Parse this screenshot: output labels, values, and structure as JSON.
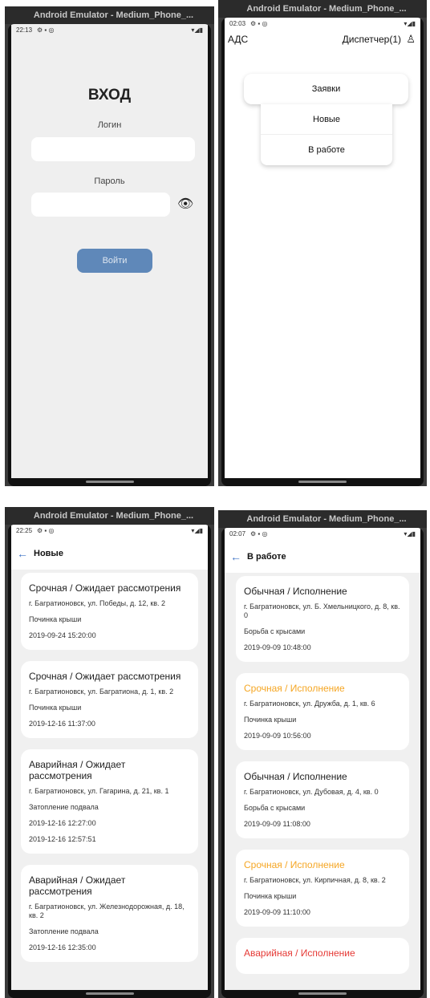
{
  "emulator": {
    "title": "Android Emulator - Medium_Phone_..."
  },
  "colors": {
    "urgent": "#f5a623",
    "emergency": "#e53935",
    "normal": "#222222",
    "accent": "#3e73c5",
    "login_button": "#5f88b9"
  },
  "login": {
    "status_time": "22:13",
    "title": "ВХОД",
    "login_label": "Логин",
    "login_value": "",
    "password_label": "Пароль",
    "password_value": "",
    "eye_icon": "eye-icon",
    "submit_label": "Войти"
  },
  "dispatcher": {
    "status_time": "02:03",
    "app_title": "АДС",
    "user_label": "Диспетчер(1)",
    "user_icon": "user-icon",
    "menu_main": "Заявки",
    "submenu": [
      "Новые",
      "В работе"
    ]
  },
  "new_list": {
    "status_time": "22:25",
    "title": "Новые",
    "cards": [
      {
        "title": "Срочная / Ожидает рассмотрения",
        "status": "normal",
        "lines": [
          "г. Багратионовск, ул. Победы, д. 12, кв. 2",
          "Починка крыши",
          "2019-09-24 15:20:00"
        ]
      },
      {
        "title": "Срочная / Ожидает рассмотрения",
        "status": "normal",
        "lines": [
          "г. Багратионовск, ул. Багратиона, д. 1, кв. 2",
          "Починка крыши",
          "2019-12-16 11:37:00"
        ]
      },
      {
        "title": "Аварийная / Ожидает рассмотрения",
        "status": "normal",
        "lines": [
          "г. Багратионовск, ул. Гагарина, д. 21, кв. 1",
          "Затопление подвала",
          "2019-12-16 12:27:00",
          "2019-12-16 12:57:51"
        ]
      },
      {
        "title": "Аварийная / Ожидает рассмотрения",
        "status": "normal",
        "lines": [
          "г. Багратионовск, ул. Железнодорожная, д. 18, кв. 2",
          "Затопление подвала",
          "2019-12-16 12:35:00"
        ]
      }
    ]
  },
  "work_list": {
    "status_time": "02:07",
    "title": "В работе",
    "cards": [
      {
        "title": "Обычная / Исполнение",
        "status": "normal",
        "lines": [
          "г. Багратионовск, ул. Б. Хмельницкого, д. 8, кв. 0",
          "Борьба с крысами",
          "2019-09-09 10:48:00"
        ]
      },
      {
        "title": "Срочная / Исполнение",
        "status": "urgent",
        "lines": [
          "г. Багратионовск, ул. Дружба, д. 1, кв. 6",
          "Починка крыши",
          "2019-09-09 10:56:00"
        ]
      },
      {
        "title": "Обычная / Исполнение",
        "status": "normal",
        "lines": [
          "г. Багратионовск, ул. Дубовая, д. 4, кв. 0",
          "Борьба с крысами",
          "2019-09-09 11:08:00"
        ]
      },
      {
        "title": "Срочная / Исполнение",
        "status": "urgent",
        "lines": [
          "г. Багратионовск, ул. Кирпичная, д. 8, кв. 2",
          "Починка крыши",
          "2019-09-09 11:10:00"
        ]
      },
      {
        "title": "Аварийная / Исполнение",
        "status": "emergency",
        "lines": []
      }
    ]
  }
}
